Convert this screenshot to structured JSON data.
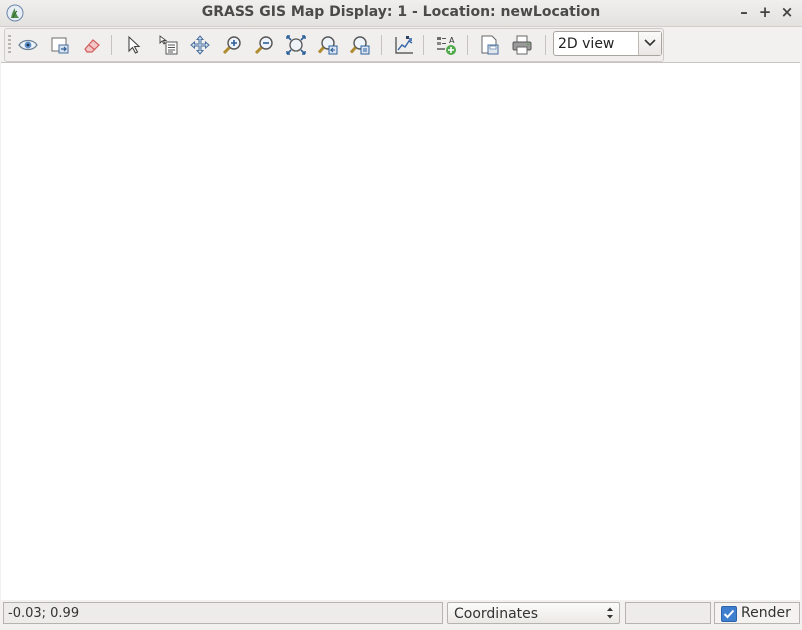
{
  "window": {
    "title": "GRASS GIS Map Display: 1  - Location: newLocation",
    "controls": [
      "minimize-icon",
      "maximize-icon",
      "close-icon"
    ]
  },
  "toolbar": {
    "buttons": [
      "eye-icon",
      "render-map-icon",
      "erase-icon",
      "pointer-icon",
      "query-icon",
      "pan-icon",
      "zoom-in-icon",
      "zoom-out-icon",
      "zoom-extent-icon",
      "zoom-back-icon",
      "zoom-menu-icon",
      "analyze-icon",
      "decoration-icon",
      "save-image-icon",
      "print-icon"
    ],
    "view_select": {
      "value": "2D view"
    }
  },
  "statusbar": {
    "coordinates": "-0.03; 0.99",
    "mode": {
      "value": "Coordinates"
    },
    "render_label": "Render",
    "render_checked": true
  },
  "colors": {
    "accent": "#3f7fd0",
    "canvas": "#ffffff"
  }
}
